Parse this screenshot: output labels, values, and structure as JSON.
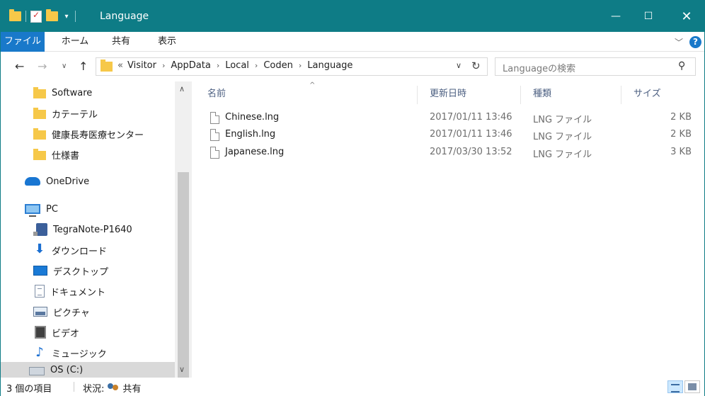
{
  "window": {
    "title": "Language"
  },
  "ribbon": {
    "tabs": [
      {
        "label": "ファイル"
      },
      {
        "label": "ホーム"
      },
      {
        "label": "共有"
      },
      {
        "label": "表示"
      }
    ]
  },
  "address": {
    "overflow": "«",
    "crumbs": [
      "Visitor",
      "AppData",
      "Local",
      "Coden",
      "Language"
    ]
  },
  "search": {
    "placeholder": "Languageの検索"
  },
  "nav_pane": {
    "items": [
      {
        "label": "Software",
        "icon": "folder-icon"
      },
      {
        "label": "カテーテル",
        "icon": "folder-icon"
      },
      {
        "label": "健康長寿医療センター",
        "icon": "folder-icon"
      },
      {
        "label": "仕様書",
        "icon": "folder-icon"
      },
      {
        "label": "OneDrive",
        "icon": "onedrive-icon"
      },
      {
        "label": "PC",
        "icon": "pc-icon"
      },
      {
        "label": "TegraNote-P1640",
        "icon": "device-icon"
      },
      {
        "label": "ダウンロード",
        "icon": "download-icon"
      },
      {
        "label": "デスクトップ",
        "icon": "desktop-icon"
      },
      {
        "label": "ドキュメント",
        "icon": "documents-icon"
      },
      {
        "label": "ピクチャ",
        "icon": "pictures-icon"
      },
      {
        "label": "ビデオ",
        "icon": "videos-icon"
      },
      {
        "label": "ミュージック",
        "icon": "music-icon"
      },
      {
        "label": "OS (C:)",
        "icon": "drive-icon"
      }
    ]
  },
  "columns": {
    "name": "名前",
    "date": "更新日時",
    "type": "種類",
    "size": "サイズ"
  },
  "files": [
    {
      "name": "Chinese.lng",
      "date": "2017/01/11 13:46",
      "type": "LNG ファイル",
      "size": "2 KB"
    },
    {
      "name": "English.lng",
      "date": "2017/01/11 13:46",
      "type": "LNG ファイル",
      "size": "2 KB"
    },
    {
      "name": "Japanese.lng",
      "date": "2017/03/30 13:52",
      "type": "LNG ファイル",
      "size": "3 KB"
    }
  ],
  "status": {
    "count": "3 個の項目",
    "state_label": "状況:",
    "state_value": "共有"
  },
  "colors": {
    "titlebar": "#0e7c86",
    "file_tab": "#1979ca",
    "selection": "#cce8ff"
  }
}
